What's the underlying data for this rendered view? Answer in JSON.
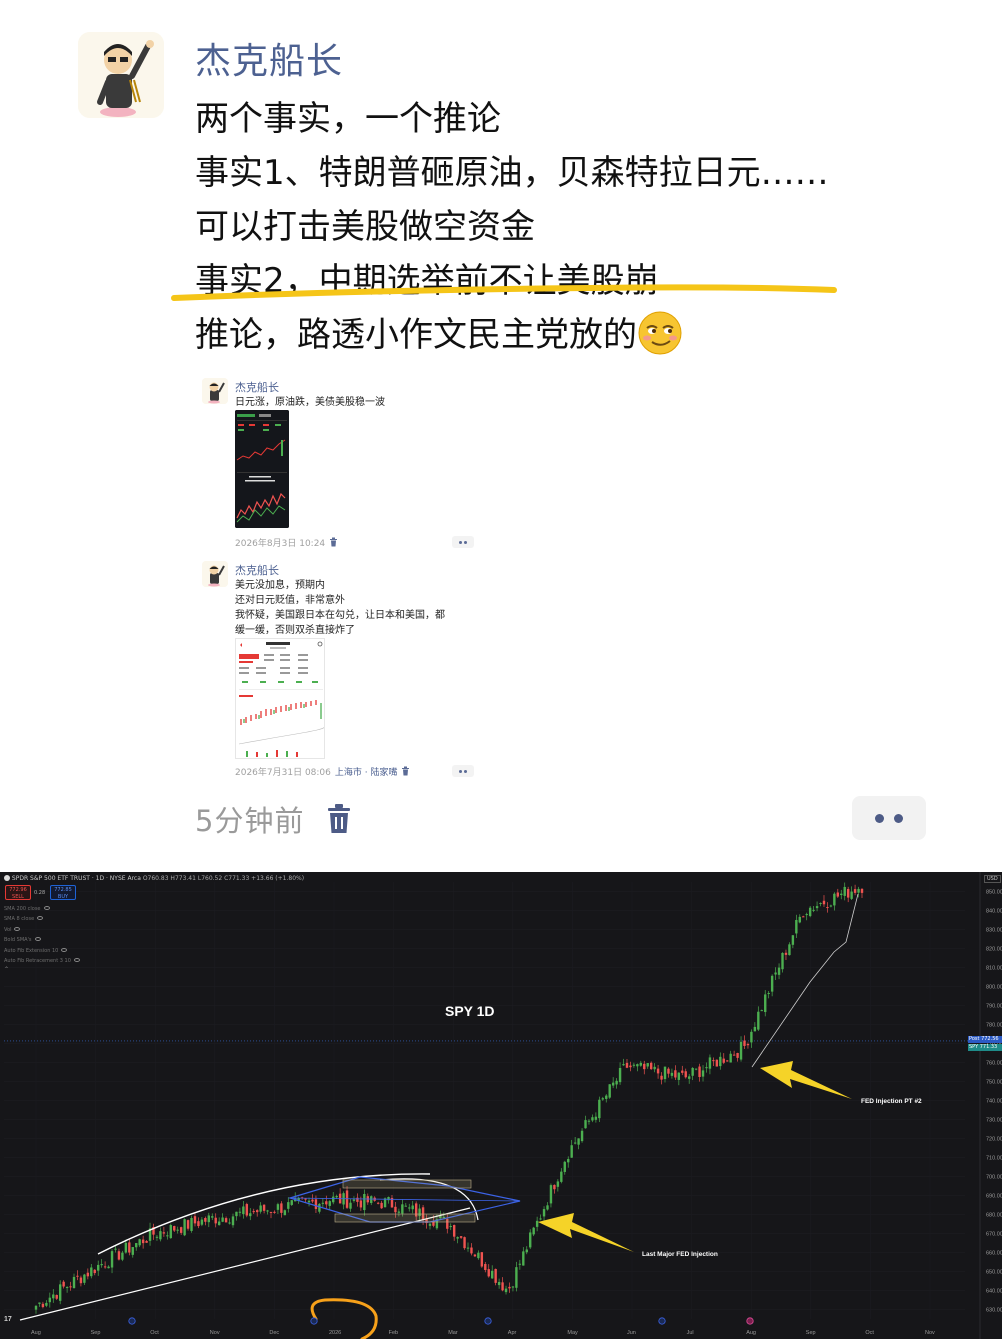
{
  "post": {
    "author": "杰克船长",
    "lines": [
      "两个事实，一个推论",
      "事实1、特朗普砸原油，贝森特拉日元……",
      "可以打击美股做空资金",
      "事实2，中期选举前不让美股崩",
      "推论，路透小作文民主党放的"
    ],
    "time": "5分钟前",
    "quotes": [
      {
        "author": "杰克船长",
        "lines": [
          "日元涨，原油跌，美债美股稳一波"
        ],
        "date": "2026年8月3日 10:24",
        "location": ""
      },
      {
        "author": "杰克船长",
        "lines": [
          "美元没加息，预期内",
          "还对日元贬值，非常意外",
          "我怀疑，美国跟日本在勾兑，让日本和美国，都",
          "缓一缓，否则双杀直接炸了"
        ],
        "date": "2026年7月31日 08:06",
        "location": "上海市 · 陆家嘴"
      }
    ]
  },
  "chart_header": {
    "symbol": "SPDR S&P 500 ETF TRUST · 1D · NYSE Arca",
    "ohlc": "O760.83 H773.41 L760.52 C771.33 +13.66 (+1.80%)",
    "sell_price": "772.96",
    "sell_label": "SELL",
    "buy_price": "772.85",
    "buy_label": "BUY",
    "spread": "0.28",
    "currency": "USD",
    "indicators": [
      "SMA 200 close",
      "SMA 8 close",
      "Vol",
      "Bold SMA's",
      "Auto Fib Extension 10",
      "Auto Fib Retracement 3 10"
    ],
    "badge_post_label": "Post",
    "badge_post_value": "772.56",
    "badge_spy_label": "SPY",
    "badge_spy_value": "771.33"
  },
  "chart_data": {
    "type": "candlestick",
    "title": "SPY 1D",
    "x_tick_labels": [
      "Aug",
      "Sep",
      "Oct",
      "Nov",
      "Dec",
      "2026",
      "Feb",
      "Mar",
      "Apr",
      "May",
      "Jun",
      "Jul",
      "Aug",
      "Sep",
      "Oct",
      "Nov"
    ],
    "y_tick_labels": [
      "850.00",
      "840.00",
      "830.00",
      "820.00",
      "810.00",
      "800.00",
      "790.00",
      "780.00",
      "770.00",
      "760.00",
      "750.00",
      "740.00",
      "730.00",
      "720.00",
      "710.00",
      "700.00",
      "690.00",
      "680.00",
      "670.00",
      "660.00",
      "650.00",
      "640.00",
      "630.00"
    ],
    "ylim": [
      625,
      855
    ],
    "annotations": [
      "FED Injection  PT #2",
      "Last Major FED Injection"
    ],
    "close_series": [
      {
        "month": "Aug",
        "close": 632
      },
      {
        "month": "Sep",
        "close": 652
      },
      {
        "month": "Oct",
        "close": 670
      },
      {
        "month": "Nov",
        "close": 678
      },
      {
        "month": "Dec",
        "close": 683
      },
      {
        "month": "2026",
        "close": 688
      },
      {
        "month": "Feb",
        "close": 686
      },
      {
        "month": "Mar",
        "close": 675
      },
      {
        "month": "Apr",
        "close": 640
      },
      {
        "month": "May",
        "close": 712
      },
      {
        "month": "Jun",
        "close": 758
      },
      {
        "month": "Jul",
        "close": 752
      },
      {
        "month": "Aug",
        "close": 768
      },
      {
        "month": "Sep",
        "close": 840
      },
      {
        "month": "Oct",
        "close": 853
      }
    ],
    "colors": {
      "up": "#4caf50",
      "down": "#ef5350",
      "annotation": "#f5d328",
      "highlight": "#f7a11a"
    }
  }
}
